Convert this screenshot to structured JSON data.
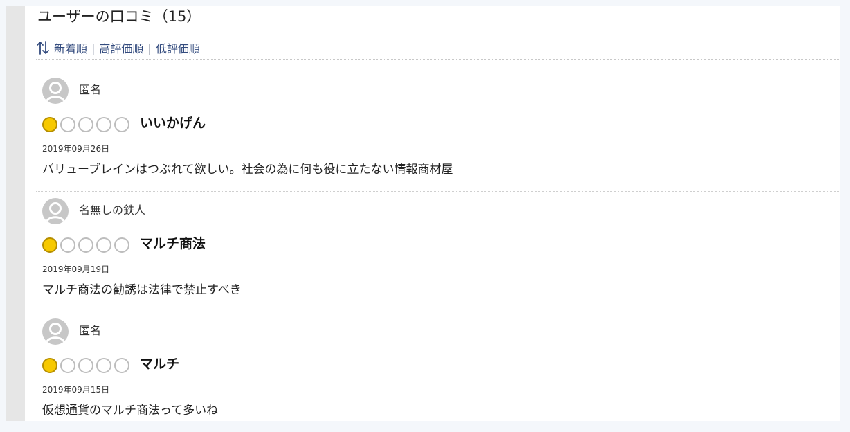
{
  "header": {
    "title": "ユーザーの口コミ（15）"
  },
  "sort": {
    "icon": "sort-arrows-icon",
    "options": [
      "新着順",
      "高評価順",
      "低評価順"
    ],
    "separator": "|"
  },
  "colors": {
    "accent_link": "#334b7e",
    "star_filled": "#f7c900"
  },
  "reviews": [
    {
      "author": "匿名",
      "rating": 1,
      "max_rating": 5,
      "title": "いいかげん",
      "date": "2019年09月26日",
      "body": "バリューブレインはつぶれて欲しい。社会の為に何も役に立たない情報商材屋"
    },
    {
      "author": "名無しの鉄人",
      "rating": 1,
      "max_rating": 5,
      "title": "マルチ商法",
      "date": "2019年09月19日",
      "body": "マルチ商法の勧誘は法律で禁止すべき"
    },
    {
      "author": "匿名",
      "rating": 1,
      "max_rating": 5,
      "title": "マルチ",
      "date": "2019年09月15日",
      "body": "仮想通貨のマルチ商法って多いね"
    }
  ]
}
